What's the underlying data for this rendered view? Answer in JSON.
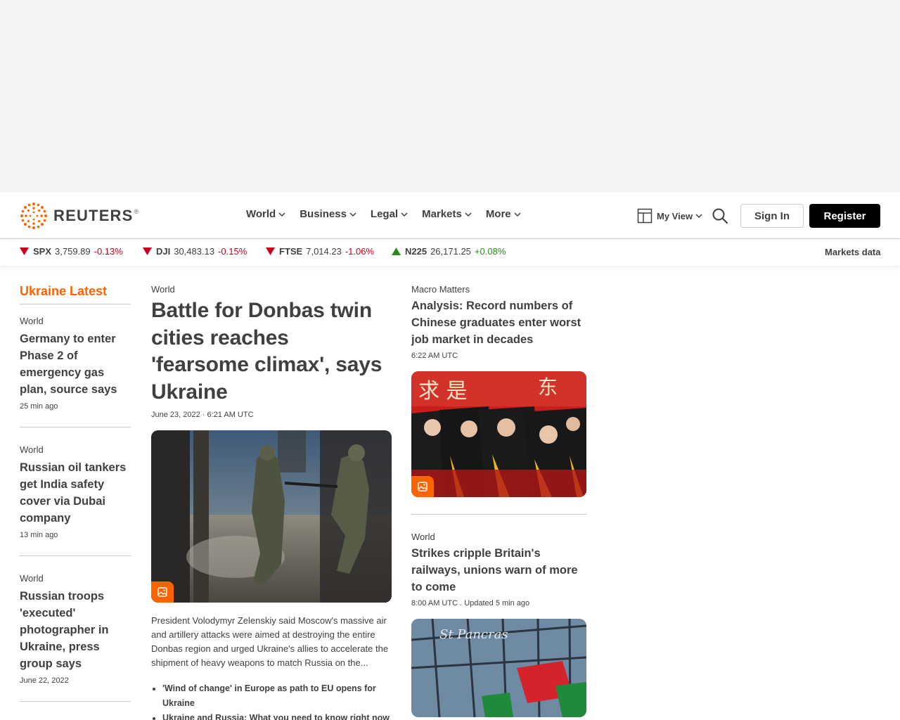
{
  "brand": {
    "name": "REUTERS",
    "reg": "®"
  },
  "nav": {
    "items": [
      {
        "label": "World"
      },
      {
        "label": "Business"
      },
      {
        "label": "Legal"
      },
      {
        "label": "Markets"
      },
      {
        "label": "More"
      }
    ],
    "my_view": "My View",
    "sign_in": "Sign In",
    "register": "Register"
  },
  "ticker": {
    "items": [
      {
        "symbol": "SPX",
        "value": "3,759.89",
        "change": "-0.13%",
        "direction": "down"
      },
      {
        "symbol": "DJI",
        "value": "30,483.13",
        "change": "-0.15%",
        "direction": "down"
      },
      {
        "symbol": "FTSE",
        "value": "7,014.23",
        "change": "-1.06%",
        "direction": "down"
      },
      {
        "symbol": "N225",
        "value": "26,171.25",
        "change": "+0.08%",
        "direction": "up"
      }
    ],
    "markets_data": "Markets data"
  },
  "left": {
    "title": "Ukraine Latest",
    "stories": [
      {
        "kicker": "World",
        "headline": "Germany to enter Phase 2 of emergency gas plan, source says",
        "time": "25 min ago"
      },
      {
        "kicker": "World",
        "headline": "Russian oil tankers get India safety cover via Dubai company",
        "time": "13 min ago"
      },
      {
        "kicker": "World",
        "headline": "Russian troops 'executed' photographer in Ukraine, press group says",
        "time": "June 22, 2022"
      }
    ]
  },
  "main": {
    "kicker": "World",
    "headline": "Battle for Donbas twin cities reaches 'fearsome climax', says Ukraine",
    "date": "June 23, 2022 · 6:21 AM UTC",
    "summary": "President Volodymyr Zelenskiy said Moscow's massive air and artillery attacks were aimed at destroying the entire Donbas region and urged Ukraine's allies to accelerate the shipment of heavy weapons to match Russia on the...",
    "related": [
      "'Wind of change' in Europe as path to EU opens for Ukraine",
      "Ukraine and Russia: What you need to know right now"
    ]
  },
  "right": {
    "stories": [
      {
        "kicker": "Macro Matters",
        "headline": "Analysis: Record numbers of Chinese graduates enter worst job market in decades",
        "time": "6:22 AM UTC"
      },
      {
        "kicker": "World",
        "headline": "Strikes cripple Britain's railways, unions warn of more to come",
        "time": "8:00 AM UTC . Updated 5 min ago"
      }
    ]
  },
  "colors": {
    "accent": "#fa6400",
    "down": "#c8001e",
    "up": "#2c8a1b",
    "register_bg": "#000000"
  }
}
